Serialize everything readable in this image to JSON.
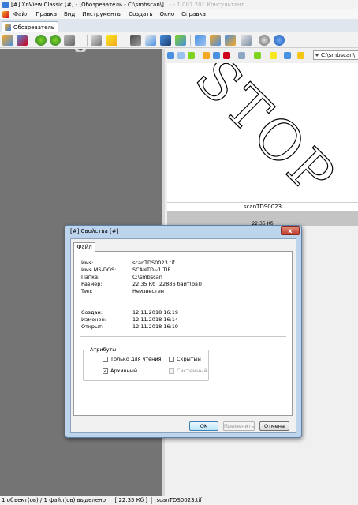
{
  "window": {
    "title": "[#] XnView Classic [#] - [Обозреватель - C:\\smbscan\\]",
    "title_ghost": "- - 1 007 201 Консультант"
  },
  "menu": [
    "Файл",
    "Правка",
    "Вид",
    "Инструменты",
    "Создать",
    "Окно",
    "Справка"
  ],
  "tab": {
    "label": "Обозреватель"
  },
  "address": {
    "value": "C:\\smbscan\\"
  },
  "thumbnail": {
    "image_text": "STOP",
    "filename": "scanTDS0023",
    "size": "22.35 Кб"
  },
  "status": {
    "selection": "1 объект(ов) / 1 файл(ов) выделено",
    "size": "[ 22.35 Кб ]",
    "file": "scanTDS0023.tif"
  },
  "dialog": {
    "title": "[#] Свойства [#]",
    "close_label": "x",
    "tab_label": "Файл",
    "info": [
      {
        "key": "Имя:",
        "value": "scanTDS0023.tif"
      },
      {
        "key": "Имя MS-DOS:",
        "value": "SCANTD~1.TIF"
      },
      {
        "key": "Папка:",
        "value": "C:\\smbscan"
      },
      {
        "key": "Размер:",
        "value": "22.35 Кб (22886 байт(ов))"
      },
      {
        "key": "Тип:",
        "value": "Неизвестен"
      }
    ],
    "dates": [
      {
        "key": "Создан:",
        "value": "12.11.2018 16:19"
      },
      {
        "key": "Изменен:",
        "value": "12.11.2018 16:14"
      },
      {
        "key": "Открыт:",
        "value": "12.11.2018 16:19"
      }
    ],
    "attributes": {
      "label": "Атрибуты",
      "readonly": {
        "label": "Только для чтения",
        "checked": false
      },
      "hidden": {
        "label": "Скрытый",
        "checked": false
      },
      "archive": {
        "label": "Архивный",
        "checked": true
      },
      "system": {
        "label": "Системный",
        "checked": false
      }
    },
    "buttons": {
      "ok": "OK",
      "apply": "Применить",
      "cancel": "Отмена"
    }
  },
  "colors": {
    "left_pane": "#747474",
    "dialog_frame": "#bcd4ec",
    "close_button": "#c0392b"
  }
}
